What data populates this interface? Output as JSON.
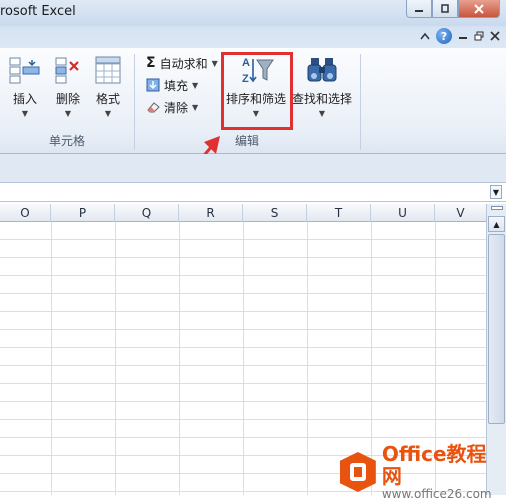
{
  "window": {
    "title": "rosoft Excel"
  },
  "ribbon": {
    "cells_group": {
      "label": "单元格",
      "insert_label": "插入",
      "delete_label": "删除",
      "format_label": "格式"
    },
    "editing_group": {
      "label": "编辑",
      "autosum_label": "自动求和",
      "fill_label": "填充",
      "clear_label": "清除",
      "sort_filter_label": "排序和筛选",
      "find_select_label": "查找和选择"
    }
  },
  "columns": [
    "O",
    "P",
    "Q",
    "R",
    "S",
    "T",
    "U",
    "V"
  ],
  "watermark": {
    "title": "Office教程网",
    "url": "www.office26.com"
  },
  "colors": {
    "highlight": "#e03030",
    "accent": "#1f64c0",
    "watermark": "#e8540f"
  }
}
